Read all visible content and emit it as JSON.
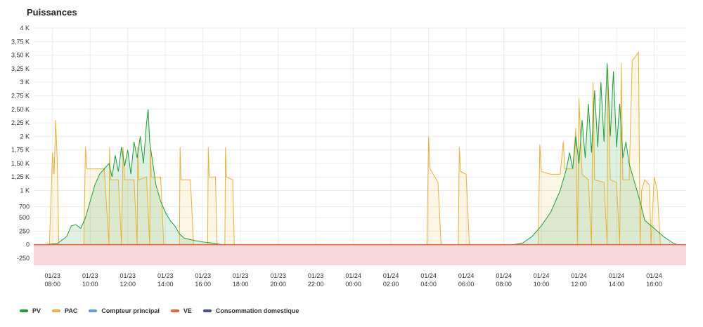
{
  "panel": {
    "title": "Puissances"
  },
  "chart_data": {
    "type": "area",
    "title": "Puissances",
    "xlabel": "",
    "ylabel": "",
    "x_range": [
      "01/23 07:00",
      "01/24 17:42"
    ],
    "ylim": [
      -380,
      4000
    ],
    "y_ticks": [
      {
        "value": 4000,
        "label": "4 K"
      },
      {
        "value": 3750,
        "label": "3,75 K"
      },
      {
        "value": 3500,
        "label": "3,50 K"
      },
      {
        "value": 3250,
        "label": "3,25 K"
      },
      {
        "value": 3000,
        "label": "3 K"
      },
      {
        "value": 2750,
        "label": "2,75 K"
      },
      {
        "value": 2500,
        "label": "2,50 K"
      },
      {
        "value": 2250,
        "label": "2,25 K"
      },
      {
        "value": 2000,
        "label": "2 K"
      },
      {
        "value": 1750,
        "label": "1,75 K"
      },
      {
        "value": 1500,
        "label": "1,50 K"
      },
      {
        "value": 1250,
        "label": "1,25 K"
      },
      {
        "value": 1000,
        "label": "1 K"
      },
      {
        "value": 700,
        "label": "700"
      },
      {
        "value": 500,
        "label": "500"
      },
      {
        "value": 250,
        "label": "250"
      },
      {
        "value": 0,
        "label": "0"
      },
      {
        "value": -250,
        "label": "-250"
      }
    ],
    "x_ticks": [
      {
        "date": "01/23",
        "time": "08:00",
        "t": "01/23 08:00"
      },
      {
        "date": "01/23",
        "time": "10:00",
        "t": "01/23 10:00"
      },
      {
        "date": "01/23",
        "time": "12:00",
        "t": "01/23 12:00"
      },
      {
        "date": "01/23",
        "time": "14:00",
        "t": "01/23 14:00"
      },
      {
        "date": "01/23",
        "time": "16:00",
        "t": "01/23 16:00"
      },
      {
        "date": "01/23",
        "time": "18:00",
        "t": "01/23 18:00"
      },
      {
        "date": "01/23",
        "time": "20:00",
        "t": "01/23 20:00"
      },
      {
        "date": "01/23",
        "time": "22:00",
        "t": "01/23 22:00"
      },
      {
        "date": "01/24",
        "time": "00:00",
        "t": "01/24 00:00"
      },
      {
        "date": "01/24",
        "time": "02:00",
        "t": "01/24 02:00"
      },
      {
        "date": "01/24",
        "time": "04:00",
        "t": "01/24 04:00"
      },
      {
        "date": "01/24",
        "time": "06:00",
        "t": "01/24 06:00"
      },
      {
        "date": "01/24",
        "time": "08:00",
        "t": "01/24 08:00"
      },
      {
        "date": "01/24",
        "time": "10:00",
        "t": "01/24 10:00"
      },
      {
        "date": "01/24",
        "time": "12:00",
        "t": "01/24 12:00"
      },
      {
        "date": "01/24",
        "time": "14:00",
        "t": "01/24 14:00"
      },
      {
        "date": "01/24",
        "time": "16:00",
        "t": "01/24 16:00"
      }
    ],
    "negative_band": {
      "from": -380,
      "to": 0,
      "color": "#f8d7da"
    },
    "legend_position": "bottom-left",
    "grid": true,
    "series": [
      {
        "name": "PV",
        "color": "#1e9e3a",
        "points": [
          [
            "01/23 07:30",
            0
          ],
          [
            "01/23 08:15",
            20
          ],
          [
            "01/23 08:45",
            150
          ],
          [
            "01/23 09:00",
            350
          ],
          [
            "01/23 09:15",
            370
          ],
          [
            "01/23 09:30",
            300
          ],
          [
            "01/23 09:45",
            500
          ],
          [
            "01/23 10:00",
            800
          ],
          [
            "01/23 10:15",
            1100
          ],
          [
            "01/23 10:30",
            1300
          ],
          [
            "01/23 10:45",
            1400
          ],
          [
            "01/23 11:00",
            1500
          ],
          [
            "01/23 11:10",
            1250
          ],
          [
            "01/23 11:20",
            1650
          ],
          [
            "01/23 11:30",
            1350
          ],
          [
            "01/23 11:40",
            1800
          ],
          [
            "01/23 11:50",
            1450
          ],
          [
            "01/23 12:00",
            1750
          ],
          [
            "01/23 12:10",
            1300
          ],
          [
            "01/23 12:20",
            1900
          ],
          [
            "01/23 12:30",
            1600
          ],
          [
            "01/23 12:40",
            2000
          ],
          [
            "01/23 12:50",
            1500
          ],
          [
            "01/23 13:00",
            2250
          ],
          [
            "01/23 13:05",
            2500
          ],
          [
            "01/23 13:10",
            1900
          ],
          [
            "01/23 13:20",
            1500
          ],
          [
            "01/23 13:30",
            1100
          ],
          [
            "01/23 13:45",
            800
          ],
          [
            "01/23 14:00",
            600
          ],
          [
            "01/23 14:15",
            450
          ],
          [
            "01/23 14:30",
            350
          ],
          [
            "01/23 14:45",
            200
          ],
          [
            "01/23 15:00",
            120
          ],
          [
            "01/23 15:30",
            80
          ],
          [
            "01/23 16:00",
            50
          ],
          [
            "01/23 16:30",
            30
          ],
          [
            "01/23 17:00",
            0
          ],
          [
            "01/24 08:30",
            0
          ],
          [
            "01/24 09:00",
            30
          ],
          [
            "01/24 09:30",
            150
          ],
          [
            "01/24 10:00",
            350
          ],
          [
            "01/24 10:30",
            600
          ],
          [
            "01/24 11:00",
            1000
          ],
          [
            "01/24 11:10",
            1200
          ],
          [
            "01/24 11:20",
            1400
          ],
          [
            "01/24 11:30",
            1700
          ],
          [
            "01/24 11:40",
            1400
          ],
          [
            "01/24 11:50",
            2000
          ],
          [
            "01/24 12:00",
            1500
          ],
          [
            "01/24 12:10",
            2300
          ],
          [
            "01/24 12:20",
            1600
          ],
          [
            "01/24 12:30",
            2600
          ],
          [
            "01/24 12:40",
            1700
          ],
          [
            "01/24 12:50",
            2850
          ],
          [
            "01/24 13:00",
            1800
          ],
          [
            "01/24 13:10",
            3000
          ],
          [
            "01/24 13:20",
            1900
          ],
          [
            "01/24 13:30",
            3350
          ],
          [
            "01/24 13:40",
            2000
          ],
          [
            "01/24 13:50",
            3200
          ],
          [
            "01/24 14:00",
            1800
          ],
          [
            "01/24 14:10",
            2600
          ],
          [
            "01/24 14:20",
            1600
          ],
          [
            "01/24 14:30",
            1900
          ],
          [
            "01/24 14:40",
            1500
          ],
          [
            "01/24 14:50",
            1300
          ],
          [
            "01/24 15:00",
            1100
          ],
          [
            "01/24 15:15",
            800
          ],
          [
            "01/24 15:30",
            450
          ],
          [
            "01/24 16:00",
            300
          ],
          [
            "01/24 16:30",
            150
          ],
          [
            "01/24 17:00",
            30
          ],
          [
            "01/24 17:15",
            0
          ]
        ]
      },
      {
        "name": "PAC",
        "color": "#e8b23a",
        "points": [
          [
            "01/23 07:50",
            0
          ],
          [
            "01/23 08:00",
            1700
          ],
          [
            "01/23 08:05",
            1300
          ],
          [
            "01/23 08:10",
            2300
          ],
          [
            "01/23 08:15",
            1550
          ],
          [
            "01/23 08:20",
            0
          ],
          [
            "01/23 09:40",
            0
          ],
          [
            "01/23 09:45",
            1800
          ],
          [
            "01/23 09:50",
            1400
          ],
          [
            "01/23 10:15",
            1400
          ],
          [
            "01/23 10:45",
            1400
          ],
          [
            "01/23 11:00",
            0
          ],
          [
            "01/23 11:02",
            1800
          ],
          [
            "01/23 11:05",
            1200
          ],
          [
            "01/23 11:30",
            1200
          ],
          [
            "01/23 11:40",
            0
          ],
          [
            "01/23 11:45",
            1800
          ],
          [
            "01/23 11:50",
            1200
          ],
          [
            "01/23 12:20",
            1200
          ],
          [
            "01/23 12:30",
            0
          ],
          [
            "01/23 12:32",
            1800
          ],
          [
            "01/23 12:35",
            1200
          ],
          [
            "01/23 13:00",
            1250
          ],
          [
            "01/23 13:10",
            0
          ],
          [
            "01/23 13:12",
            1800
          ],
          [
            "01/23 13:15",
            1250
          ],
          [
            "01/23 13:45",
            1250
          ],
          [
            "01/23 13:55",
            0
          ],
          [
            "01/23 14:45",
            0
          ],
          [
            "01/23 14:47",
            1800
          ],
          [
            "01/23 14:50",
            1200
          ],
          [
            "01/23 15:20",
            1200
          ],
          [
            "01/23 15:30",
            0
          ],
          [
            "01/23 16:15",
            0
          ],
          [
            "01/23 16:17",
            1800
          ],
          [
            "01/23 16:20",
            1250
          ],
          [
            "01/23 16:40",
            1250
          ],
          [
            "01/23 16:45",
            0
          ],
          [
            "01/23 17:10",
            0
          ],
          [
            "01/23 17:12",
            1800
          ],
          [
            "01/23 17:15",
            1250
          ],
          [
            "01/23 17:35",
            1200
          ],
          [
            "01/23 17:40",
            0
          ],
          [
            "01/24 03:55",
            0
          ],
          [
            "01/24 04:00",
            2000
          ],
          [
            "01/24 04:05",
            1400
          ],
          [
            "01/24 04:30",
            1150
          ],
          [
            "01/24 04:40",
            0
          ],
          [
            "01/24 05:35",
            0
          ],
          [
            "01/24 05:38",
            1800
          ],
          [
            "01/24 05:42",
            1350
          ],
          [
            "01/24 06:00",
            1300
          ],
          [
            "01/24 06:10",
            0
          ],
          [
            "01/24 09:50",
            0
          ],
          [
            "01/24 09:55",
            1850
          ],
          [
            "01/24 10:00",
            1350
          ],
          [
            "01/24 10:30",
            1300
          ],
          [
            "01/24 11:00",
            1300
          ],
          [
            "01/24 11:10",
            1900
          ],
          [
            "01/24 11:15",
            1400
          ],
          [
            "01/24 11:40",
            1400
          ],
          [
            "01/24 11:50",
            2150
          ],
          [
            "01/24 11:55",
            0
          ],
          [
            "01/24 12:00",
            2700
          ],
          [
            "01/24 12:10",
            1300
          ],
          [
            "01/24 12:30",
            1200
          ],
          [
            "01/24 12:40",
            0
          ],
          [
            "01/24 12:45",
            3000
          ],
          [
            "01/24 12:50",
            1200
          ],
          [
            "01/24 13:20",
            1150
          ],
          [
            "01/24 13:30",
            0
          ],
          [
            "01/24 13:32",
            3250
          ],
          [
            "01/24 13:40",
            1200
          ],
          [
            "01/24 14:00",
            1150
          ],
          [
            "01/24 14:10",
            0
          ],
          [
            "01/24 14:15",
            3350
          ],
          [
            "01/24 14:20",
            1200
          ],
          [
            "01/24 14:40",
            1200
          ],
          [
            "01/24 14:50",
            3400
          ],
          [
            "01/24 15:10",
            3550
          ],
          [
            "01/24 15:15",
            0
          ],
          [
            "01/24 15:20",
            1000
          ],
          [
            "01/24 15:30",
            1200
          ],
          [
            "01/24 15:45",
            1100
          ],
          [
            "01/24 15:50",
            0
          ],
          [
            "01/24 16:00",
            1250
          ],
          [
            "01/24 16:10",
            1000
          ],
          [
            "01/24 16:20",
            0
          ]
        ]
      },
      {
        "name": "Compteur principal",
        "color": "#6b9ae6",
        "points": []
      },
      {
        "name": "VE",
        "color": "#e0682b",
        "points": [
          [
            "01/23 07:00",
            0
          ],
          [
            "01/24 17:42",
            0
          ]
        ]
      },
      {
        "name": "Consommation domestique",
        "color": "#4b4aa0",
        "points": []
      }
    ]
  }
}
